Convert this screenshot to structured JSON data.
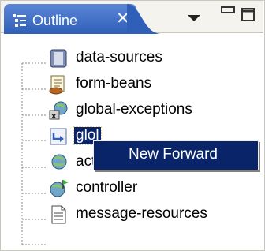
{
  "view": {
    "tab_label": "Outline",
    "close_glyph": "✕"
  },
  "tree": {
    "items": [
      {
        "label": "data-sources",
        "icon": "data-sources-icon"
      },
      {
        "label": "form-beans",
        "icon": "form-beans-icon"
      },
      {
        "label": "global-exceptions",
        "icon": "global-exceptions-icon"
      },
      {
        "label": "glol",
        "icon": "global-forwards-icon",
        "selected": true
      },
      {
        "label": "action-mappings",
        "icon": "action-mappings-icon"
      },
      {
        "label": "controller",
        "icon": "controller-icon"
      },
      {
        "label": "message-resources",
        "icon": "message-resources-icon"
      }
    ]
  },
  "context_menu": {
    "items": [
      {
        "label": "New Forward"
      }
    ]
  },
  "colors": {
    "tab_gradient_top": "#5b86d6",
    "tab_gradient_bottom": "#2f5fb8",
    "selection": "#0a246a"
  }
}
